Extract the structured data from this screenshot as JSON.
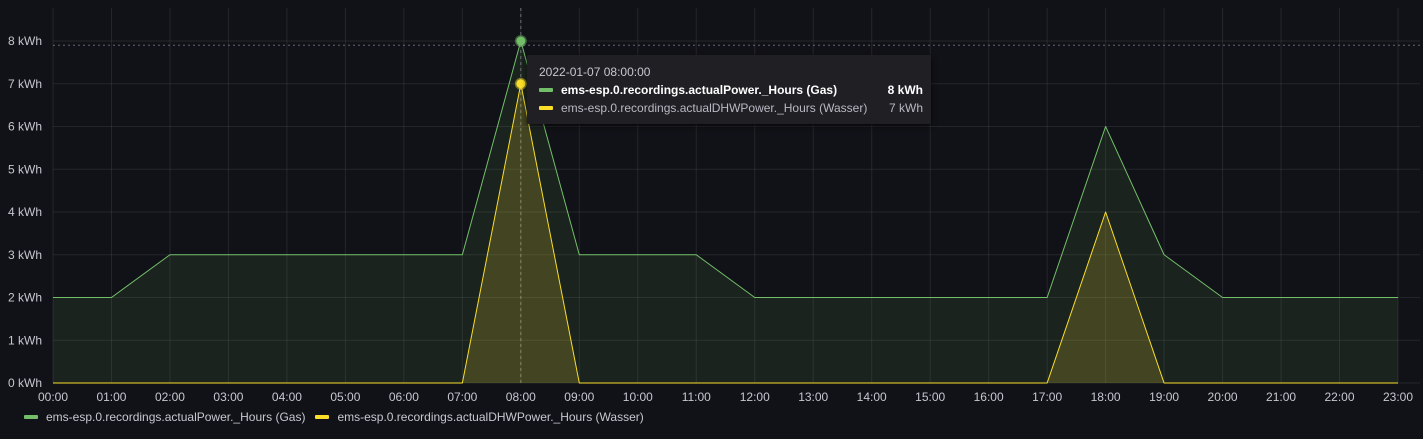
{
  "chart_data": {
    "type": "area",
    "x": [
      "00:00",
      "01:00",
      "02:00",
      "03:00",
      "04:00",
      "05:00",
      "06:00",
      "07:00",
      "08:00",
      "09:00",
      "10:00",
      "11:00",
      "12:00",
      "13:00",
      "14:00",
      "15:00",
      "16:00",
      "17:00",
      "18:00",
      "19:00",
      "20:00",
      "21:00",
      "22:00",
      "23:00"
    ],
    "series": [
      {
        "name": "ems-esp.0.recordings.actualPower._Hours (Gas)",
        "color": "#73bf69",
        "values": [
          2,
          2,
          3,
          3,
          3,
          3,
          3,
          3,
          8,
          3,
          3,
          3,
          2,
          2,
          2,
          2,
          2,
          2,
          6,
          3,
          2,
          2,
          2,
          2
        ]
      },
      {
        "name": "ems-esp.0.recordings.actualDHWPower._Hours (Wasser)",
        "color": "#fade2a",
        "values": [
          0,
          0,
          0,
          0,
          0,
          0,
          0,
          0,
          7,
          0,
          0,
          0,
          0,
          0,
          0,
          0,
          0,
          0,
          4,
          0,
          0,
          0,
          0,
          0
        ]
      }
    ],
    "ylim": [
      0,
      8
    ],
    "yticks": [
      "0 kWh",
      "1 kWh",
      "2 kWh",
      "3 kWh",
      "4 kWh",
      "5 kWh",
      "6 kWh",
      "7 kWh",
      "8 kWh"
    ],
    "grid": true,
    "legend_position": "bottom-left",
    "threshold_line": 7.9,
    "hover_index": 8
  },
  "tooltip": {
    "time": "2022-01-07 08:00:00",
    "rows": [
      {
        "name": "ems-esp.0.recordings.actualPower._Hours (Gas)",
        "value": "8 kWh",
        "color": "#73bf69"
      },
      {
        "name": "ems-esp.0.recordings.actualDHWPower._Hours (Wasser)",
        "value": "7 kWh",
        "color": "#fade2a"
      }
    ]
  }
}
